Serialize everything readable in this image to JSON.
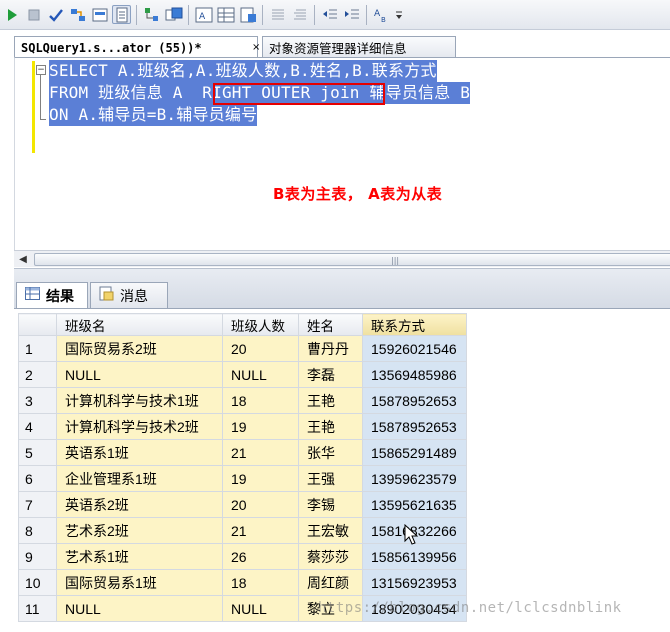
{
  "toolbar": {
    "icons": [
      "play-icon",
      "stop-icon",
      "check-icon",
      "parse-icon",
      "display-plan-icon",
      "query-options-icon",
      "include-plan-icon",
      "client-stats-icon",
      "results-text-icon",
      "results-grid-icon",
      "results-file-icon",
      "comment-icon",
      "uncomment-icon",
      "decrease-indent-icon",
      "increase-indent-icon",
      "specify-values-icon"
    ]
  },
  "tabs": {
    "query_tab": "SQLQuery1.s...ator (55))*",
    "close_glyph": "×",
    "object_explorer_tab": "对象资源管理器详细信息"
  },
  "editor": {
    "collapse_glyph": "−",
    "lines": [
      "SELECT A.班级名,A.班级人数,B.姓名,B.联系方式",
      "FROM 班级信息 A  RIGHT OUTER join 辅导员信息 B",
      "ON A.辅导员=B.辅导员编号"
    ],
    "annotation": "B表为主表， A表为从表",
    "highlight_color": "#e60000"
  },
  "results": {
    "tab_results": "结果",
    "tab_messages": "消息",
    "columns": [
      "",
      "班级名",
      "班级人数",
      "姓名",
      "联系方式"
    ],
    "rows": [
      [
        "1",
        "国际贸易系2班",
        "20",
        "曹丹丹",
        "15926021546"
      ],
      [
        "2",
        "NULL",
        "NULL",
        "李磊",
        "13569485986"
      ],
      [
        "3",
        "计算机科学与技术1班",
        "18",
        "王艳",
        "15878952653"
      ],
      [
        "4",
        "计算机科学与技术2班",
        "19",
        "王艳",
        "15878952653"
      ],
      [
        "5",
        "英语系1班",
        "21",
        "张华",
        "15865291489"
      ],
      [
        "6",
        "企业管理系1班",
        "19",
        "王强",
        "13959623579"
      ],
      [
        "7",
        "英语系2班",
        "20",
        "李锡",
        "13595621635"
      ],
      [
        "8",
        "艺术系2班",
        "21",
        "王宏敏",
        "15816832266"
      ],
      [
        "9",
        "艺术系1班",
        "26",
        "蔡莎莎",
        "15856139956"
      ],
      [
        "10",
        "国际贸易系1班",
        "18",
        "周红颜",
        "13156923953"
      ],
      [
        "11",
        "NULL",
        "NULL",
        "黎立",
        "18902030454"
      ]
    ],
    "null_rows": [
      1,
      10
    ]
  },
  "watermark": "https://blog.csdn.net/lclcsdnblink"
}
